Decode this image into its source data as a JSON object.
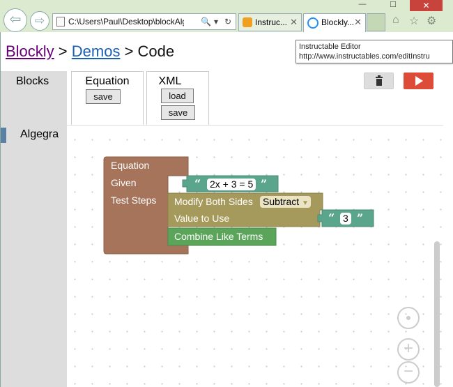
{
  "browser": {
    "address": "C:\\Users\\Paul\\Desktop\\blockAlg\\d",
    "search_icon": "🔍",
    "dropdown_icon": "▾",
    "refresh_icon": "↻",
    "tabs": [
      {
        "title": "Instruc...",
        "icon_color": "#f0a020"
      },
      {
        "title": "Blockly...",
        "icon_color": "#1e90ff"
      }
    ],
    "close_glyph": "✕"
  },
  "breadcrumb": {
    "blockly": "Blockly",
    "sep1": " > ",
    "demos": "Demos",
    "sep2": " > ",
    "current": "Code"
  },
  "tooltip": {
    "line1": "Instructable Editor",
    "line2": "http://www.instructables.com/editInstru"
  },
  "tabs": {
    "blocks": "Blocks",
    "equation": {
      "label": "Equation",
      "save": "save"
    },
    "xml": {
      "label": "XML",
      "load": "load",
      "save": "save"
    }
  },
  "toolbox": {
    "categories": [
      {
        "label": "Algegra",
        "color": "#5b80a5"
      }
    ]
  },
  "blocks": {
    "equation": {
      "title": "Equation",
      "given_label": "Given",
      "given_value": "2x + 3 = 5",
      "steps_label": "Test Steps",
      "color": "#a5745b"
    },
    "modify": {
      "label": "Modify Both Sides",
      "operation": "Subtract",
      "value_label": "Value to Use",
      "value": "3",
      "color": "#a59a5b"
    },
    "combine": {
      "label": "Combine Like Terms",
      "color": "#5ba55b"
    },
    "text_color": "#5ba58c"
  },
  "quotes": {
    "open": "“",
    "close": "”"
  }
}
